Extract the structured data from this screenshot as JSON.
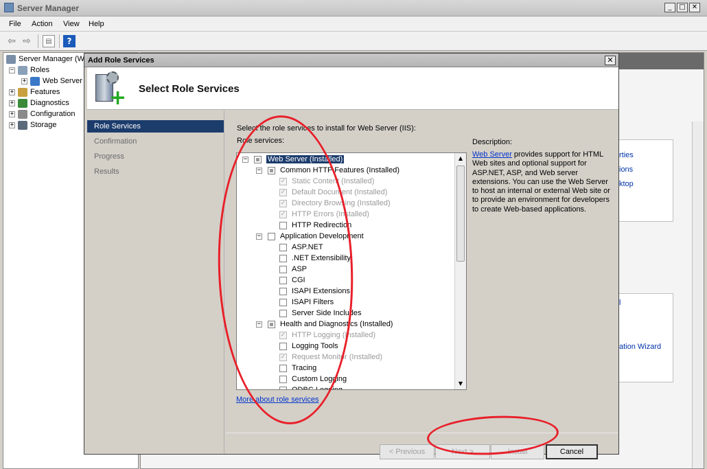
{
  "main_window": {
    "title": "Server Manager",
    "minimize": "_",
    "maximize": "□",
    "close": "✕"
  },
  "menu": [
    "File",
    "Action",
    "View",
    "Help"
  ],
  "tree": {
    "root": "Server Manager (W",
    "roles": "Roles",
    "web_server": "Web Server",
    "features": "Features",
    "diagnostics": "Diagnostics",
    "configuration": "Configuration",
    "storage": "Storage"
  },
  "right_pane_links": [
    "rties",
    "ions",
    "ktop",
    "l",
    "ation Wizard"
  ],
  "dialog": {
    "title": "Add Role Services",
    "close": "✕",
    "header_title": "Select Role Services",
    "nav": [
      "Role Services",
      "Confirmation",
      "Progress",
      "Results"
    ],
    "instruction": "Select the role services to install for Web Server (IIS):",
    "role_services_label": "Role services:",
    "description_label": "Description:",
    "description_link": "Web Server",
    "description_text": " provides support for HTML Web sites and optional support for ASP.NET, ASP, and Web server extensions. You can use the Web Server to host an internal or external Web site or to provide an environment for developers to create Web-based applications.",
    "more_link": "More about role services",
    "buttons": {
      "previous": "< Previous",
      "next": "Next >",
      "install": "Install",
      "cancel": "Cancel"
    }
  },
  "role_services": [
    {
      "label": "Web Server  (Installed)",
      "level": 0,
      "expander": "−",
      "check": "tri",
      "selected": true
    },
    {
      "label": "Common HTTP Features  (Installed)",
      "level": 1,
      "expander": "−",
      "check": "tri"
    },
    {
      "label": "Static Content  (Installed)",
      "level": 2,
      "check": "checked-disabled"
    },
    {
      "label": "Default Document  (Installed)",
      "level": 2,
      "check": "checked-disabled"
    },
    {
      "label": "Directory Browsing  (Installed)",
      "level": 2,
      "check": "checked-disabled"
    },
    {
      "label": "HTTP Errors  (Installed)",
      "level": 2,
      "check": "checked-disabled"
    },
    {
      "label": "HTTP Redirection",
      "level": 2,
      "check": "unchecked"
    },
    {
      "label": "Application Development",
      "level": 1,
      "expander": "−",
      "check": "unchecked"
    },
    {
      "label": "ASP.NET",
      "level": 2,
      "check": "unchecked"
    },
    {
      "label": ".NET Extensibility",
      "level": 2,
      "check": "unchecked"
    },
    {
      "label": "ASP",
      "level": 2,
      "check": "unchecked"
    },
    {
      "label": "CGI",
      "level": 2,
      "check": "unchecked"
    },
    {
      "label": "ISAPI Extensions",
      "level": 2,
      "check": "unchecked"
    },
    {
      "label": "ISAPI Filters",
      "level": 2,
      "check": "unchecked"
    },
    {
      "label": "Server Side Includes",
      "level": 2,
      "check": "unchecked"
    },
    {
      "label": "Health and Diagnostics  (Installed)",
      "level": 1,
      "expander": "−",
      "check": "tri"
    },
    {
      "label": "HTTP Logging  (Installed)",
      "level": 2,
      "check": "checked-disabled"
    },
    {
      "label": "Logging Tools",
      "level": 2,
      "check": "unchecked"
    },
    {
      "label": "Request Monitor  (Installed)",
      "level": 2,
      "check": "checked-disabled"
    },
    {
      "label": "Tracing",
      "level": 2,
      "check": "unchecked"
    },
    {
      "label": "Custom Logging",
      "level": 2,
      "check": "unchecked"
    },
    {
      "label": "ODBC Logging",
      "level": 2,
      "check": "unchecked"
    }
  ],
  "colors": {
    "selection": "#1c3c6c",
    "annotation": "#e8202a",
    "link": "#0033cc"
  }
}
